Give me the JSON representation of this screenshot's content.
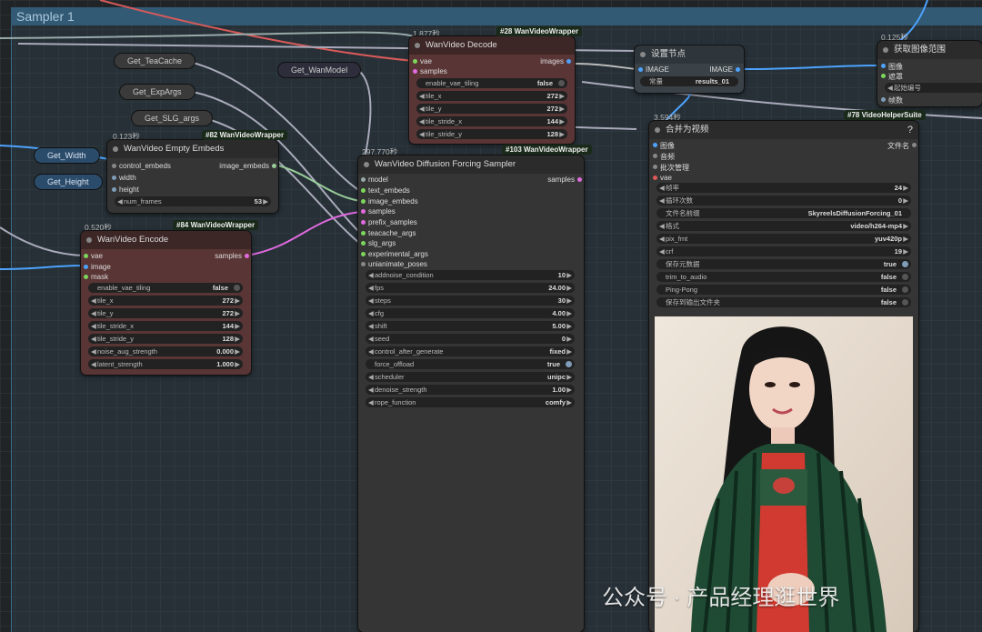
{
  "group": {
    "title": "Sampler 1"
  },
  "get_nodes": {
    "teacache": "Get_TeaCache",
    "expargs": "Get_ExpArgs",
    "slgargs": "Get_SLG_args",
    "wanmodel": "Get_WanModel",
    "width": "Get_Width",
    "height": "Get_Height"
  },
  "decode": {
    "time": "1.877秒",
    "badge": "#28 WanVideoWrapper",
    "title": "WanVideo Decode",
    "in_vae": "vae",
    "in_samples": "samples",
    "out_images": "images",
    "widgets": [
      {
        "label": "enable_vae_tiling",
        "value": "false"
      },
      {
        "label": "tile_x",
        "value": "272"
      },
      {
        "label": "tile_y",
        "value": "272"
      },
      {
        "label": "tile_stride_x",
        "value": "144"
      },
      {
        "label": "tile_stride_y",
        "value": "128"
      }
    ]
  },
  "setnode": {
    "title": "设置节点",
    "in_image": "IMAGE",
    "out_image": "IMAGE",
    "constant_label": "常量",
    "constant_value": "results_01"
  },
  "range": {
    "time": "0.125秒",
    "title": "获取图像范围",
    "in_image": "图像",
    "in_mask": "遮罩",
    "widget_label": "起始编号",
    "frames": "帧数"
  },
  "embeds": {
    "time": "0.123秒",
    "badge": "#82 WanVideoWrapper",
    "title": "WanVideo Empty Embeds",
    "in_control": "control_embeds",
    "in_width": "width",
    "in_height": "height",
    "out": "image_embeds",
    "widget": {
      "label": "num_frames",
      "value": "53"
    }
  },
  "sampler": {
    "time": "297.770秒",
    "badge": "#103 WanVideoWrapper",
    "title": "WanVideo Diffusion Forcing Sampler",
    "inputs": [
      "model",
      "text_embeds",
      "image_embeds",
      "samples",
      "prefix_samples",
      "teacache_args",
      "slg_args",
      "experimental_args",
      "unianimate_poses"
    ],
    "out": "samples",
    "widgets": [
      {
        "label": "addnoise_condition",
        "value": "10"
      },
      {
        "label": "fps",
        "value": "24.00"
      },
      {
        "label": "steps",
        "value": "30"
      },
      {
        "label": "cfg",
        "value": "4.00"
      },
      {
        "label": "shift",
        "value": "5.00"
      },
      {
        "label": "seed",
        "value": "0"
      },
      {
        "label": "control_after_generate",
        "value": "fixed"
      },
      {
        "label": "force_offload",
        "value": "true"
      },
      {
        "label": "scheduler",
        "value": "unipc"
      },
      {
        "label": "denoise_strength",
        "value": "1.00"
      },
      {
        "label": "rope_function",
        "value": "comfy"
      }
    ]
  },
  "encode": {
    "time": "0.520秒",
    "badge": "#84 WanVideoWrapper",
    "title": "WanVideo Encode",
    "inputs": [
      "vae",
      "image",
      "mask"
    ],
    "out": "samples",
    "widgets": [
      {
        "label": "enable_vae_tiling",
        "value": "false"
      },
      {
        "label": "tile_x",
        "value": "272"
      },
      {
        "label": "tile_y",
        "value": "272"
      },
      {
        "label": "tile_stride_x",
        "value": "144"
      },
      {
        "label": "tile_stride_y",
        "value": "128"
      },
      {
        "label": "noise_aug_strength",
        "value": "0.000"
      },
      {
        "label": "latent_strength",
        "value": "1.000"
      }
    ]
  },
  "video": {
    "time": "3.594秒",
    "badge": "#78 VideoHelperSuite",
    "title": "合并为视频",
    "help": "?",
    "inputs": [
      "图像",
      "音频",
      "批次管理",
      "vae"
    ],
    "out": "文件名",
    "widgets": [
      {
        "label": "帧率",
        "value": "24"
      },
      {
        "label": "循环次数",
        "value": "0"
      },
      {
        "label": "文件名前缀",
        "value": "SkyreelsDiffusionForcing_01"
      },
      {
        "label": "格式",
        "value": "video/h264-mp4"
      },
      {
        "label": "pix_fmt",
        "value": "yuv420p"
      },
      {
        "label": "crf",
        "value": "19"
      },
      {
        "label": "保存元数据",
        "value": "true"
      },
      {
        "label": "trim_to_audio",
        "value": "false"
      },
      {
        "label": "Ping-Pong",
        "value": "false"
      },
      {
        "label": "保存到输出文件夹",
        "value": "false"
      }
    ]
  },
  "watermark": "公众号 · 产品经理逛世界",
  "colors": {
    "accent_blue": "#4da3ff",
    "wire_pink": "#e06ae0",
    "wire_red": "#e05a5a",
    "node_red": "#5a3535",
    "node_gray": "#353535"
  }
}
